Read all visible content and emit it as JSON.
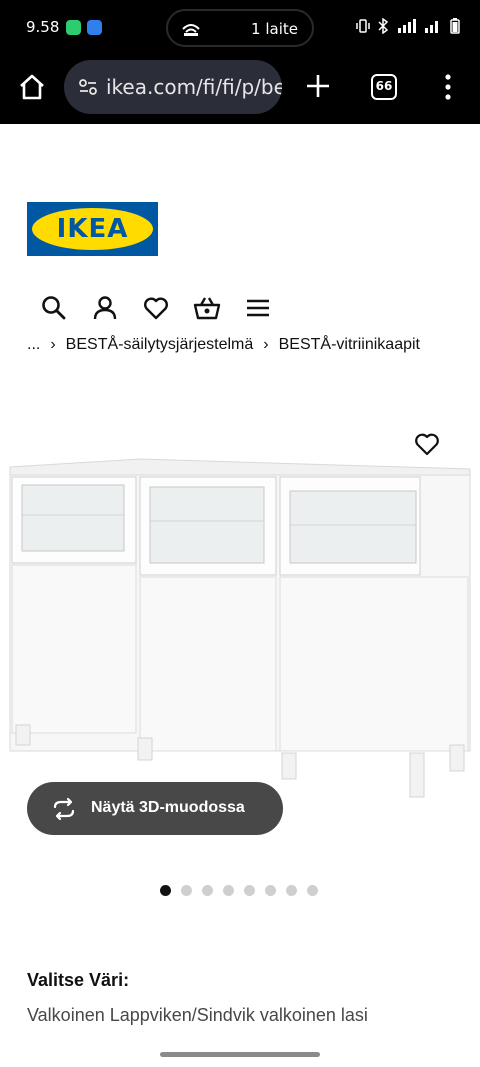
{
  "status_bar": {
    "time": "9.58",
    "device_pill_text": "1 laite"
  },
  "browser": {
    "url": "ikea.com/fi/fi/p/besta",
    "tab_count": "66"
  },
  "site": {
    "logo_text": "IKEA",
    "brand_colors": {
      "blue": "#0058a3",
      "yellow": "#ffdb00"
    }
  },
  "nav_icons": [
    "search-icon",
    "account-icon",
    "favorites-icon",
    "cart-icon",
    "menu-icon"
  ],
  "breadcrumb": {
    "ellipsis": "...",
    "separator": "›",
    "items": [
      "BESTÅ-säilytysjärjestelmä",
      "BESTÅ-vitriinikaapit"
    ]
  },
  "product": {
    "view_3d_label": "Näytä 3D-muodossa",
    "image_count": 8,
    "active_image": 1,
    "color_heading": "Valitse Väri:",
    "color_value": "Valkoinen Lappviken/Sindvik valkoinen lasi"
  }
}
